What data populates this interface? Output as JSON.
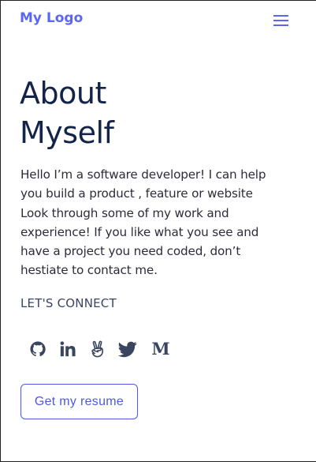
{
  "navbar": {
    "logo_text": "My Logo",
    "menu_icon": "hamburger-menu-icon"
  },
  "hero": {
    "title_line1": "About",
    "title_line2": "Myself"
  },
  "bio": {
    "lines": [
      "Hello I’m a software developer! I can help",
      "you build a product , feature or website",
      "Look through some of my work and",
      "experience! If you like what you see and",
      "have a project you need coded, don’t",
      "hestiate to contact me."
    ]
  },
  "connect": {
    "label": "LET'S CONNECT"
  },
  "social": {
    "icons": [
      "github-icon",
      "linkedin-icon",
      "angellist-icon",
      "twitter-icon",
      "medium-icon"
    ],
    "medium_glyph": "M"
  },
  "resume": {
    "button_label": "Get my resume"
  },
  "colors": {
    "accent": "#5a67f2",
    "heading": "#132448",
    "body_text": "#2c2c3a",
    "icon": "#3a4560",
    "button_border": "#4b59e6"
  }
}
